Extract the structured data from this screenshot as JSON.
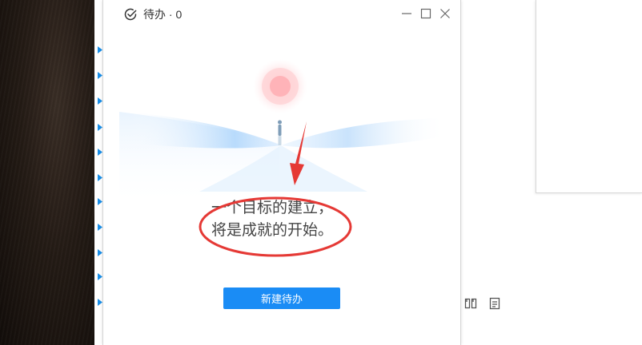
{
  "window": {
    "title": "待办 · 0",
    "controls": {
      "minimize_icon": "minimize-icon",
      "maximize_icon": "maximize-icon",
      "close_icon": "close-icon"
    }
  },
  "empty_state": {
    "line1": "一个目标的建立，",
    "line2": "将是成就的开始。",
    "button_label": "新建待办"
  },
  "colors": {
    "accent": "#1a8cf5",
    "annotation_red": "#e53935",
    "sun": "#ff9aa2"
  },
  "icons": {
    "title": "check-circle-icon",
    "background_toolbar": [
      "bookmark-icon",
      "document-icon"
    ]
  }
}
